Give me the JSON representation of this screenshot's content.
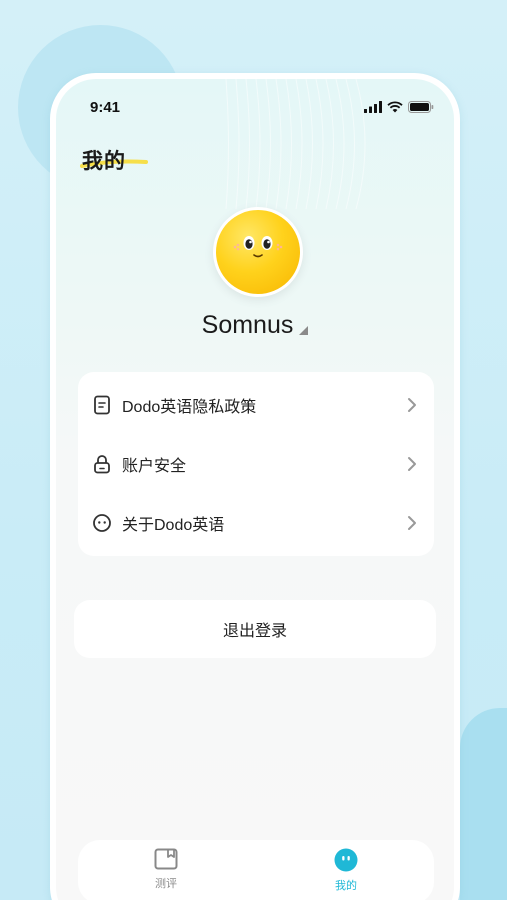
{
  "status_bar": {
    "time": "9:41"
  },
  "page": {
    "title": "我的"
  },
  "profile": {
    "username": "Somnus"
  },
  "menu": [
    {
      "label": "Dodo英语隐私政策",
      "icon": "document-icon"
    },
    {
      "label": "账户安全",
      "icon": "lock-icon"
    },
    {
      "label": "关于Dodo英语",
      "icon": "smiley-icon"
    }
  ],
  "logout": {
    "label": "退出登录"
  },
  "tabs": [
    {
      "label": "测评",
      "icon": "assessment-icon",
      "active": false
    },
    {
      "label": "我的",
      "icon": "profile-icon",
      "active": true
    }
  ],
  "colors": {
    "accent": "#1fb8d6",
    "inactive": "#8a8a8a",
    "avatar": "#ffd21c"
  }
}
